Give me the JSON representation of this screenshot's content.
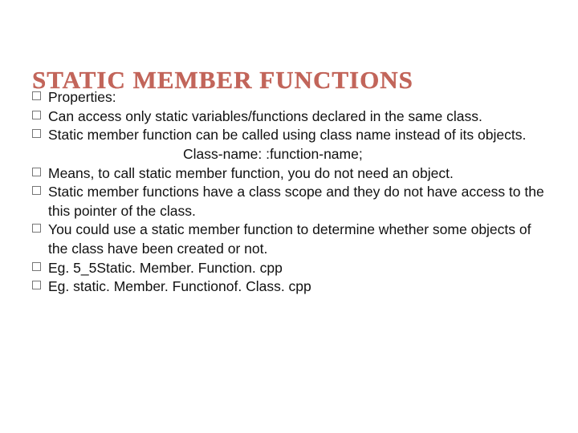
{
  "title": "STATIC MEMBER FUNCTIONS",
  "bullets": {
    "b0": "Properties:",
    "b1": "Can access only static variables/functions declared in the same class.",
    "b2": "Static member function can be called using class name instead of its objects.",
    "b2_code": "Class-name: :function-name;",
    "b3": "Means, to call static member function, you do not need an object.",
    "b4": "Static member functions have a class scope and they do not have access to the this pointer of the class.",
    "b5": "You could use a static member function to determine whether some objects of the class have been created or not.",
    "b6": "Eg. 5_5Static. Member. Function. cpp",
    "b7": "Eg. static. Member. Functionof. Class. cpp"
  }
}
